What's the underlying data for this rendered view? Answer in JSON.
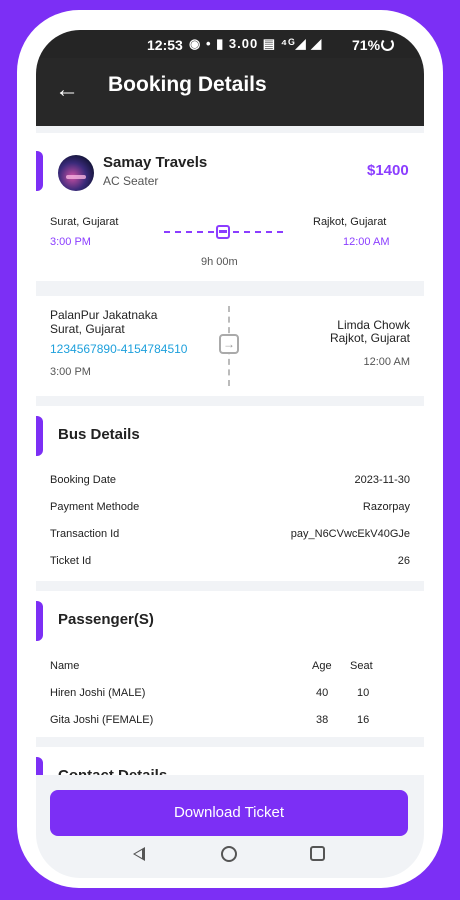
{
  "status_bar": {
    "time": "12:53",
    "icons": "◉ • ▮ 3.00 ▤ ⁴ᴳ◢ ◢",
    "battery": "71%"
  },
  "header": {
    "title": "Booking Details"
  },
  "operator": {
    "name": "Samay Travels",
    "bus_type": "AC Seater",
    "price": "$1400",
    "from_city": "Surat, Gujarat",
    "from_time": "3:00 PM",
    "to_city": "Rajkot, Gujarat",
    "to_time": "12:00 AM",
    "duration": "9h 00m"
  },
  "points": {
    "boarding_line1": "PalanPur Jakatnaka",
    "boarding_line2": "Surat, Gujarat",
    "boarding_phone": "1234567890-4154784510",
    "boarding_time": "3:00 PM",
    "drop_line1": "Limda Chowk",
    "drop_line2": "Rajkot, Gujarat",
    "drop_time": "12:00 AM"
  },
  "bus_details": {
    "title": "Bus Details",
    "rows": [
      {
        "label": "Booking Date",
        "value": "2023-11-30"
      },
      {
        "label": "Payment Methode",
        "value": "Razorpay"
      },
      {
        "label": "Transaction Id",
        "value": "pay_N6CVwcEkV40GJe"
      },
      {
        "label": "Ticket Id",
        "value": "26"
      }
    ]
  },
  "passengers": {
    "title": "Passenger(S)",
    "headers": {
      "name": "Name",
      "age": "Age",
      "seat": "Seat"
    },
    "rows": [
      {
        "name": "Hiren Joshi (MALE)",
        "age": "40",
        "seat": "10"
      },
      {
        "name": "Gita Joshi  (FEMALE)",
        "age": "38",
        "seat": "16"
      }
    ]
  },
  "contact": {
    "title": "Contact Details"
  },
  "actions": {
    "download_label": "Download Ticket"
  },
  "colors": {
    "accent": "#7c2ff5",
    "link": "#1ea0dc",
    "appbar": "#282828"
  }
}
